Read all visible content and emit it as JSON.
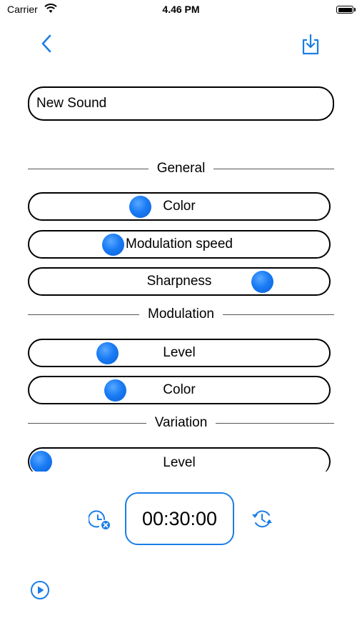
{
  "status_bar": {
    "carrier": "Carrier",
    "time": "4.46 PM"
  },
  "nav": {
    "back_icon": "chevron-left-icon",
    "save_icon": "tray-download-icon"
  },
  "sound_name": {
    "value": "New Sound"
  },
  "sections": {
    "general": "General",
    "modulation": "Modulation",
    "variation": "Variation"
  },
  "sliders": {
    "general_color": {
      "label": "Color",
      "value": 0.36
    },
    "general_modulation_speed": {
      "label": "Modulation speed",
      "value": 0.26
    },
    "general_sharpness": {
      "label": "Sharpness",
      "value": 0.8
    },
    "modulation_level": {
      "label": "Level",
      "value": 0.24
    },
    "modulation_color": {
      "label": "Color",
      "value": 0.27
    },
    "variation_level": {
      "label": "Level",
      "value": 0.0
    }
  },
  "timer": {
    "value": "00:30:00",
    "clear_icon": "clock-clear-icon",
    "reset_icon": "clock-reset-icon"
  },
  "playback": {
    "play_icon": "play-circle-icon"
  },
  "colors": {
    "accent": "#1a7ee6",
    "knob": "#1a7cf5"
  }
}
